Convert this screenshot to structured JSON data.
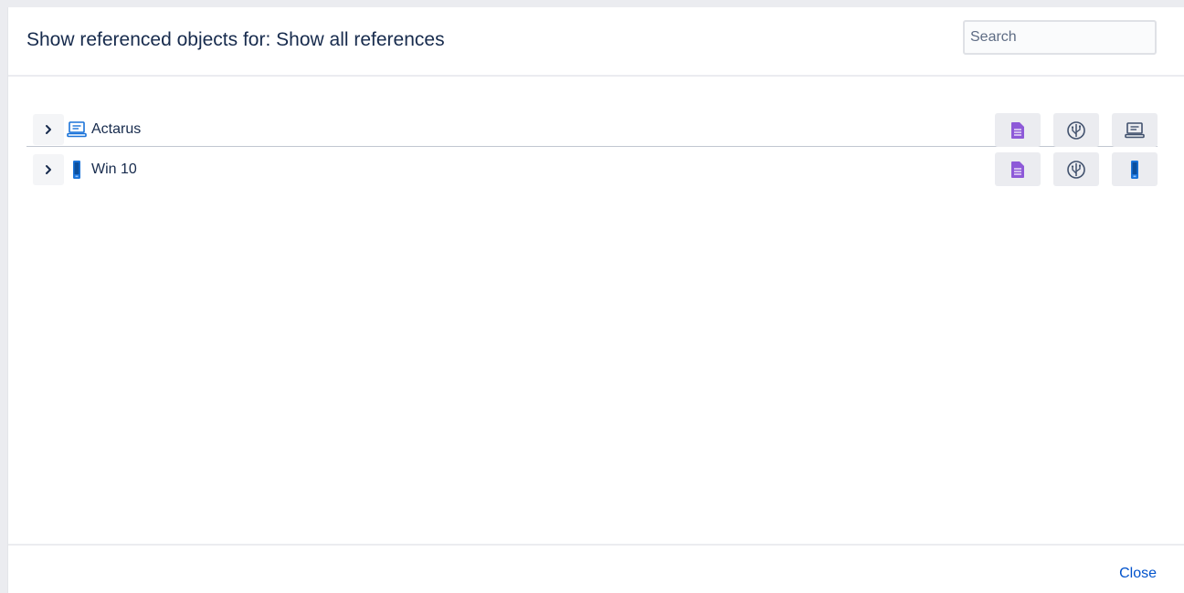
{
  "dialog": {
    "title": "Show referenced objects for: Show all references",
    "search_placeholder": "Search",
    "search_value": ""
  },
  "references": [
    {
      "label": "Actarus",
      "icon": "laptop-icon",
      "actions": [
        "document-list-icon",
        "usb-icon",
        "laptop-icon"
      ]
    },
    {
      "label": "Win 10",
      "icon": "mobile-device-icon",
      "actions": [
        "document-list-icon",
        "usb-icon",
        "mobile-device-icon"
      ]
    }
  ],
  "footer": {
    "close_label": "Close"
  },
  "colors": {
    "accent": "#0052cc",
    "doc_icon": "#8e5ad8",
    "device_icon": "#1a73d9",
    "text": "#172b4d"
  }
}
